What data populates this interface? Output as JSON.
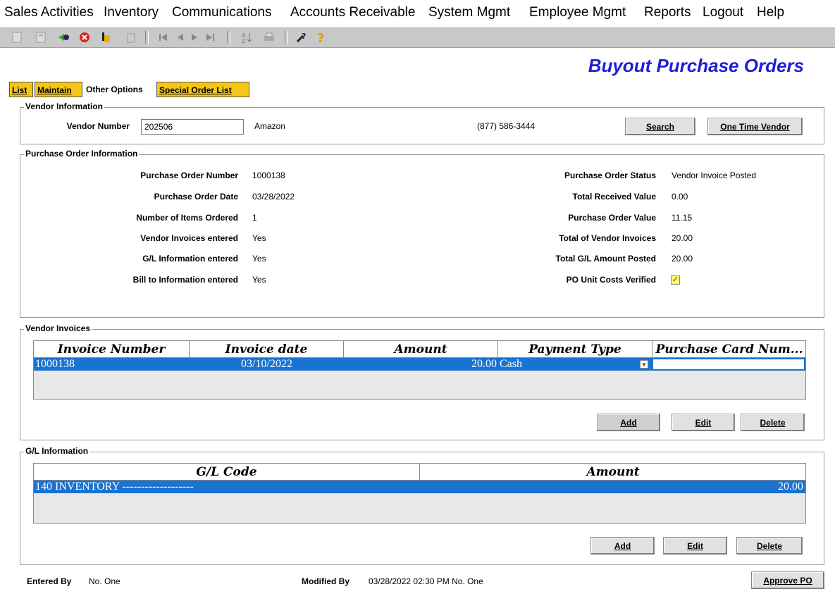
{
  "menu": {
    "items": [
      "Sales Activities",
      "Inventory",
      "Communications",
      "Accounts Receivable",
      "System Mgmt",
      "Employee Mgmt",
      "Reports",
      "Logout",
      "Help"
    ]
  },
  "toolbar": {
    "icons": [
      "new-document-icon",
      "save-icon",
      "go-icon",
      "cancel-icon",
      "print-preview-icon",
      "delete-icon",
      "first-record-icon",
      "previous-record-icon",
      "next-record-icon",
      "last-record-icon",
      "sort-icon",
      "print-icon",
      "context-help-icon",
      "help-icon"
    ]
  },
  "page": {
    "title": "Buyout Purchase Orders"
  },
  "tabs": {
    "list": "List",
    "maintain": "Maintain",
    "other_options": "Other Options",
    "special_order_list": "Special Order List"
  },
  "vendor": {
    "legend": "Vendor Information",
    "number_label": "Vendor Number",
    "number_value": "202506",
    "name": "Amazon",
    "phone": "(877) 586-3444",
    "search_button": "Search",
    "one_time_vendor_button": "One Time Vendor"
  },
  "po_info": {
    "legend": "Purchase Order Information",
    "left": [
      {
        "label": "Purchase Order Number",
        "value": "1000138"
      },
      {
        "label": "Purchase Order Date",
        "value": "03/28/2022"
      },
      {
        "label": "Number of Items Ordered",
        "value": "1"
      },
      {
        "label": "Vendor Invoices entered",
        "value": "Yes"
      },
      {
        "label": "G/L Information entered",
        "value": "Yes"
      },
      {
        "label": "Bill to Information entered",
        "value": "Yes"
      }
    ],
    "right": [
      {
        "label": "Purchase Order Status",
        "value": "Vendor Invoice Posted"
      },
      {
        "label": "Total Received Value",
        "value": "0.00"
      },
      {
        "label": "Purchase Order Value",
        "value": "11.15"
      },
      {
        "label": "Total of Vendor Invoices",
        "value": "20.00"
      },
      {
        "label": "Total G/L Amount Posted",
        "value": "20.00"
      },
      {
        "label": "PO Unit Costs Verified",
        "value": "✓"
      }
    ]
  },
  "vendor_invoices": {
    "legend": "Vendor Invoices",
    "columns": [
      "Invoice Number",
      "Invoice date",
      "Amount",
      "Payment Type",
      "Purchase Card Num..."
    ],
    "rows": [
      {
        "invoice_number": "1000138",
        "invoice_date": "03/10/2022",
        "amount": "20.00",
        "payment_type": "Cash",
        "purchase_card": ""
      }
    ],
    "add_button": "Add",
    "edit_button": "Edit",
    "delete_button": "Delete"
  },
  "gl_info": {
    "legend": "G/L Information",
    "columns": [
      "G/L Code",
      "Amount"
    ],
    "rows": [
      {
        "code": "140 INVENTORY -------------------",
        "amount": "20.00"
      }
    ],
    "add_button": "Add",
    "edit_button": "Edit",
    "delete_button": "Delete"
  },
  "footer": {
    "entered_by_label": "Entered By",
    "entered_by_value": "No. One",
    "modified_by_label": "Modified By",
    "modified_by_value": "03/28/2022 02:30 PM No. One",
    "approve_button": "Approve PO"
  },
  "colors": {
    "title": "#1f1fd6",
    "tab": "#f5c518",
    "selection": "#1a73d0",
    "toolbar": "#c8c8c8"
  }
}
